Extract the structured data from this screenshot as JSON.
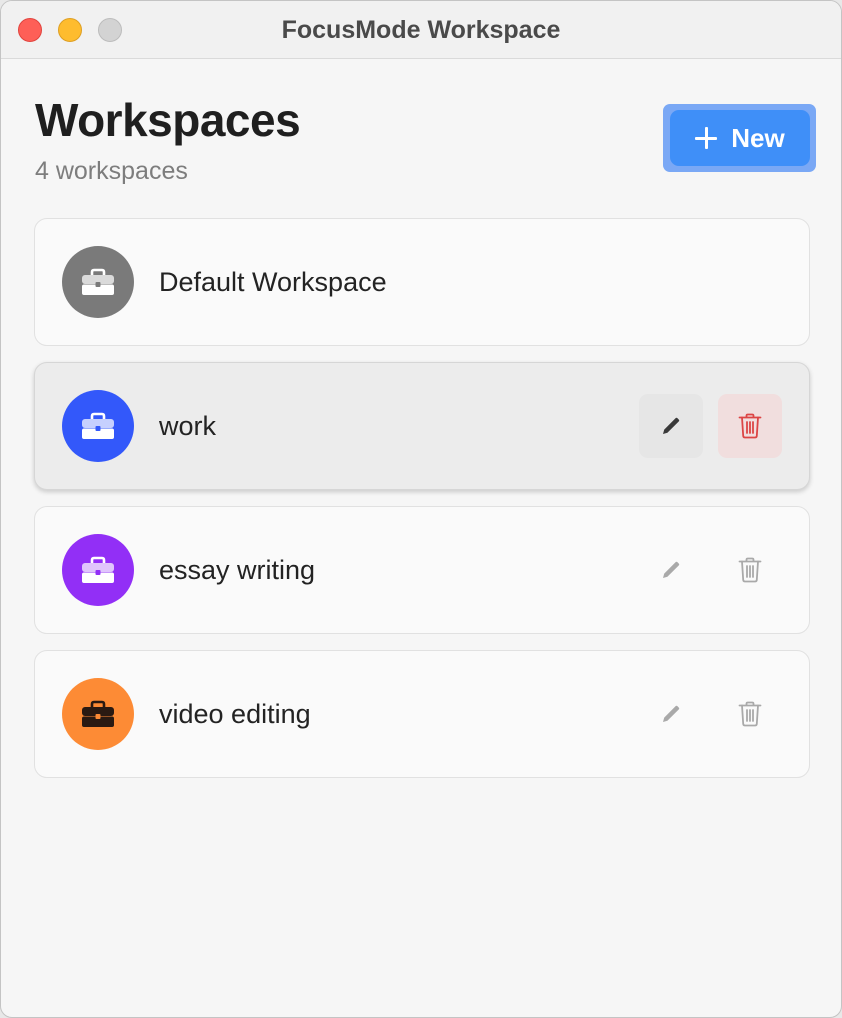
{
  "window": {
    "title": "FocusMode Workspace"
  },
  "header": {
    "title": "Workspaces",
    "subtitle": "4 workspaces",
    "new_button_label": "New"
  },
  "workspaces": [
    {
      "name": "Default Workspace",
      "color": "#7a7a7a",
      "icon": "briefcase-icon",
      "selected": false,
      "editable": false
    },
    {
      "name": "work",
      "color": "#3358fa",
      "icon": "briefcase-icon",
      "selected": true,
      "editable": true
    },
    {
      "name": "essay writing",
      "color": "#922ff6",
      "icon": "briefcase-icon",
      "selected": false,
      "editable": true
    },
    {
      "name": "video editing",
      "color": "#fd8b35",
      "icon": "briefcase-icon",
      "selected": false,
      "editable": true
    }
  ],
  "colors": {
    "accent": "#3f8ff8",
    "delete_active": "#dc4545"
  }
}
